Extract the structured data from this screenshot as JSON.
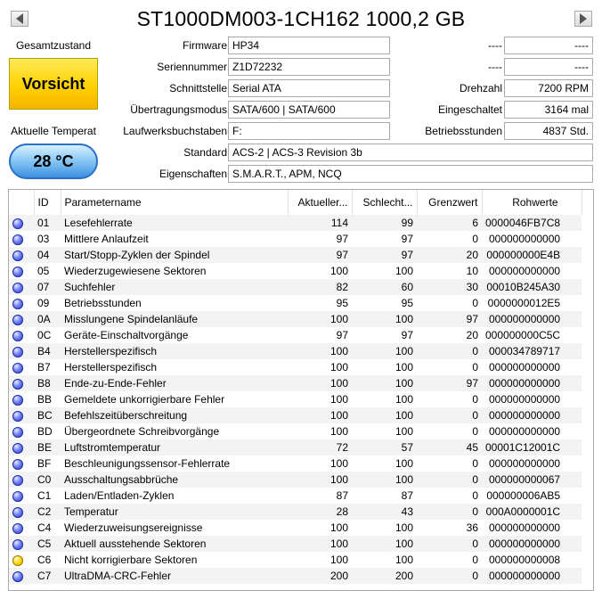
{
  "title": "ST1000DM003-1CH162 1000,2 GB",
  "health": {
    "label": "Gesamtzustand",
    "status": "Vorsicht",
    "status_color": "#ffd200"
  },
  "temperature": {
    "label": "Aktuelle Temperat",
    "value": "28 °C"
  },
  "info": {
    "firmware": {
      "label": "Firmware",
      "value": "HP34"
    },
    "serial": {
      "label": "Seriennummer",
      "value": "Z1D72232"
    },
    "interface": {
      "label": "Schnittstelle",
      "value": "Serial ATA"
    },
    "transfer": {
      "label": "Übertragungsmodus",
      "value": "SATA/600 | SATA/600"
    },
    "drive_letter": {
      "label": "Laufwerksbuchstaben",
      "value": "F:"
    },
    "standard": {
      "label": "Standard",
      "value": "ACS-2 | ACS-3 Revision 3b"
    },
    "features": {
      "label": "Eigenschaften",
      "value": "S.M.A.R.T., APM, NCQ"
    }
  },
  "right_info": {
    "blank1": {
      "label": "----",
      "value": "----"
    },
    "blank2": {
      "label": "----",
      "value": "----"
    },
    "rpm": {
      "label": "Drehzahl",
      "value": "7200 RPM"
    },
    "power_on_count": {
      "label": "Eingeschaltet",
      "value": "3164 mal"
    },
    "power_on_hours": {
      "label": "Betriebsstunden",
      "value": "4837 Std."
    }
  },
  "table": {
    "headers": [
      "ID",
      "Parametername",
      "Aktueller...",
      "Schlecht...",
      "Grenzwert",
      "Rohwerte"
    ],
    "rows": [
      {
        "status": "ok",
        "id": "01",
        "name": "Lesefehlerrate",
        "cur": "114",
        "worst": "99",
        "thr": "6",
        "raw": "0000046FB7C8"
      },
      {
        "status": "ok",
        "id": "03",
        "name": "Mittlere Anlaufzeit",
        "cur": "97",
        "worst": "97",
        "thr": "0",
        "raw": "000000000000"
      },
      {
        "status": "ok",
        "id": "04",
        "name": "Start/Stopp-Zyklen der Spindel",
        "cur": "97",
        "worst": "97",
        "thr": "20",
        "raw": "000000000E4B"
      },
      {
        "status": "ok",
        "id": "05",
        "name": "Wiederzugewiesene Sektoren",
        "cur": "100",
        "worst": "100",
        "thr": "10",
        "raw": "000000000000"
      },
      {
        "status": "ok",
        "id": "07",
        "name": "Suchfehler",
        "cur": "82",
        "worst": "60",
        "thr": "30",
        "raw": "00010B245A30"
      },
      {
        "status": "ok",
        "id": "09",
        "name": "Betriebsstunden",
        "cur": "95",
        "worst": "95",
        "thr": "0",
        "raw": "0000000012E5"
      },
      {
        "status": "ok",
        "id": "0A",
        "name": "Misslungene Spindelanläufe",
        "cur": "100",
        "worst": "100",
        "thr": "97",
        "raw": "000000000000"
      },
      {
        "status": "ok",
        "id": "0C",
        "name": "Geräte-Einschaltvorgänge",
        "cur": "97",
        "worst": "97",
        "thr": "20",
        "raw": "000000000C5C"
      },
      {
        "status": "ok",
        "id": "B4",
        "name": "Herstellerspezifisch",
        "cur": "100",
        "worst": "100",
        "thr": "0",
        "raw": "000034789717"
      },
      {
        "status": "ok",
        "id": "B7",
        "name": "Herstellerspezifisch",
        "cur": "100",
        "worst": "100",
        "thr": "0",
        "raw": "000000000000"
      },
      {
        "status": "ok",
        "id": "B8",
        "name": "Ende-zu-Ende-Fehler",
        "cur": "100",
        "worst": "100",
        "thr": "97",
        "raw": "000000000000"
      },
      {
        "status": "ok",
        "id": "BB",
        "name": "Gemeldete unkorrigierbare Fehler",
        "cur": "100",
        "worst": "100",
        "thr": "0",
        "raw": "000000000000"
      },
      {
        "status": "ok",
        "id": "BC",
        "name": "Befehlszeitüberschreitung",
        "cur": "100",
        "worst": "100",
        "thr": "0",
        "raw": "000000000000"
      },
      {
        "status": "ok",
        "id": "BD",
        "name": "Übergeordnete Schreibvorgänge",
        "cur": "100",
        "worst": "100",
        "thr": "0",
        "raw": "000000000000"
      },
      {
        "status": "ok",
        "id": "BE",
        "name": "Luftstromtemperatur",
        "cur": "72",
        "worst": "57",
        "thr": "45",
        "raw": "00001C12001C"
      },
      {
        "status": "ok",
        "id": "BF",
        "name": "Beschleunigungssensor-Fehlerrate",
        "cur": "100",
        "worst": "100",
        "thr": "0",
        "raw": "000000000000"
      },
      {
        "status": "ok",
        "id": "C0",
        "name": "Ausschaltungsabbrüche",
        "cur": "100",
        "worst": "100",
        "thr": "0",
        "raw": "000000000067"
      },
      {
        "status": "ok",
        "id": "C1",
        "name": "Laden/Entladen-Zyklen",
        "cur": "87",
        "worst": "87",
        "thr": "0",
        "raw": "000000006AB5"
      },
      {
        "status": "ok",
        "id": "C2",
        "name": "Temperatur",
        "cur": "28",
        "worst": "43",
        "thr": "0",
        "raw": "000A0000001C"
      },
      {
        "status": "ok",
        "id": "C4",
        "name": "Wiederzuweisungsereignisse",
        "cur": "100",
        "worst": "100",
        "thr": "36",
        "raw": "000000000000"
      },
      {
        "status": "ok",
        "id": "C5",
        "name": "Aktuell ausstehende Sektoren",
        "cur": "100",
        "worst": "100",
        "thr": "0",
        "raw": "000000000000"
      },
      {
        "status": "warn",
        "id": "C6",
        "name": "Nicht korrigierbare Sektoren",
        "cur": "100",
        "worst": "100",
        "thr": "0",
        "raw": "000000000008"
      },
      {
        "status": "ok",
        "id": "C7",
        "name": "UltraDMA-CRC-Fehler",
        "cur": "200",
        "worst": "200",
        "thr": "0",
        "raw": "000000000000"
      }
    ]
  },
  "icons": {
    "prev": "triangle-left-icon",
    "next": "triangle-right-icon",
    "ok_dot": "blue-status-dot-icon",
    "warn_dot": "yellow-status-dot-icon"
  }
}
